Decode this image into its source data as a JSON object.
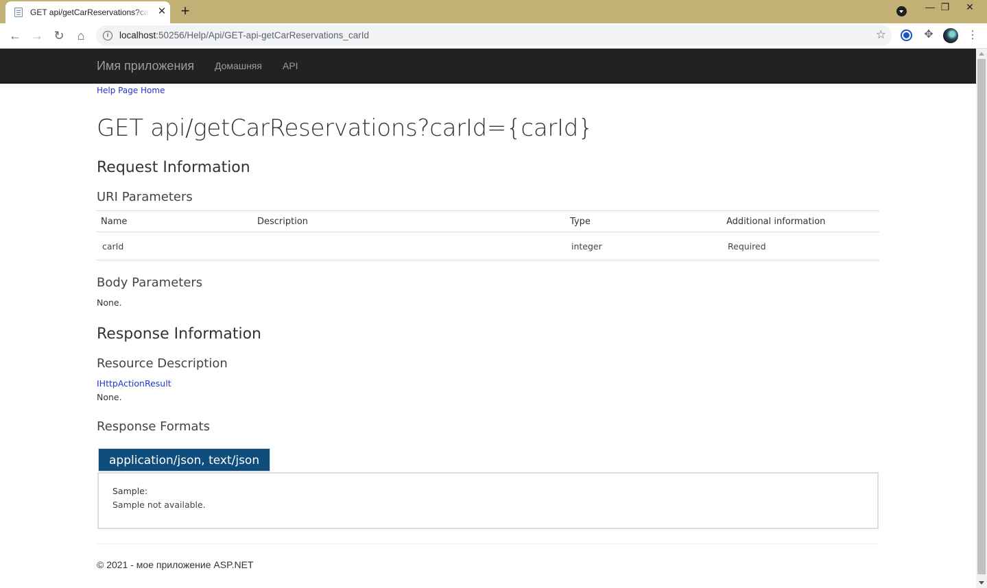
{
  "browser": {
    "tab_title": "GET api/getCarReservations?carId={carId}",
    "new_tab": "+",
    "tab_close": "✕",
    "url_host": "localhost",
    "url_rest": ":50256/Help/Api/GET-api-getCarReservations_carId",
    "window_minimize": "—",
    "window_restore": "❐",
    "window_close": "✕"
  },
  "navbar": {
    "brand": "Имя приложения",
    "links": [
      "Домашняя",
      "API"
    ]
  },
  "page": {
    "breadcrumb": "Help Page Home",
    "title": "GET api/getCarReservations?carId={carId}",
    "request_heading": "Request Information",
    "uri_params_heading": "URI Parameters",
    "table_headers": [
      "Name",
      "Description",
      "Type",
      "Additional information"
    ],
    "table_rows": [
      {
        "name": "carId",
        "description": "",
        "type": "integer",
        "additional": "Required"
      }
    ],
    "body_params_heading": "Body Parameters",
    "body_params_value": "None.",
    "response_heading": "Response Information",
    "resource_desc_heading": "Resource Description",
    "resource_type_link": "IHttpActionResult",
    "resource_desc_value": "None.",
    "response_formats_heading": "Response Formats",
    "format_tab": "application/json, text/json",
    "sample_label": "Sample:",
    "sample_value": "Sample not available."
  },
  "footer": {
    "text": "© 2021 - мое приложение ASP.NET"
  },
  "colors": {
    "tabstrip": "#c2b074",
    "navbar": "#222222",
    "format_tab": "#0e4d7c",
    "link": "#2135d1"
  }
}
